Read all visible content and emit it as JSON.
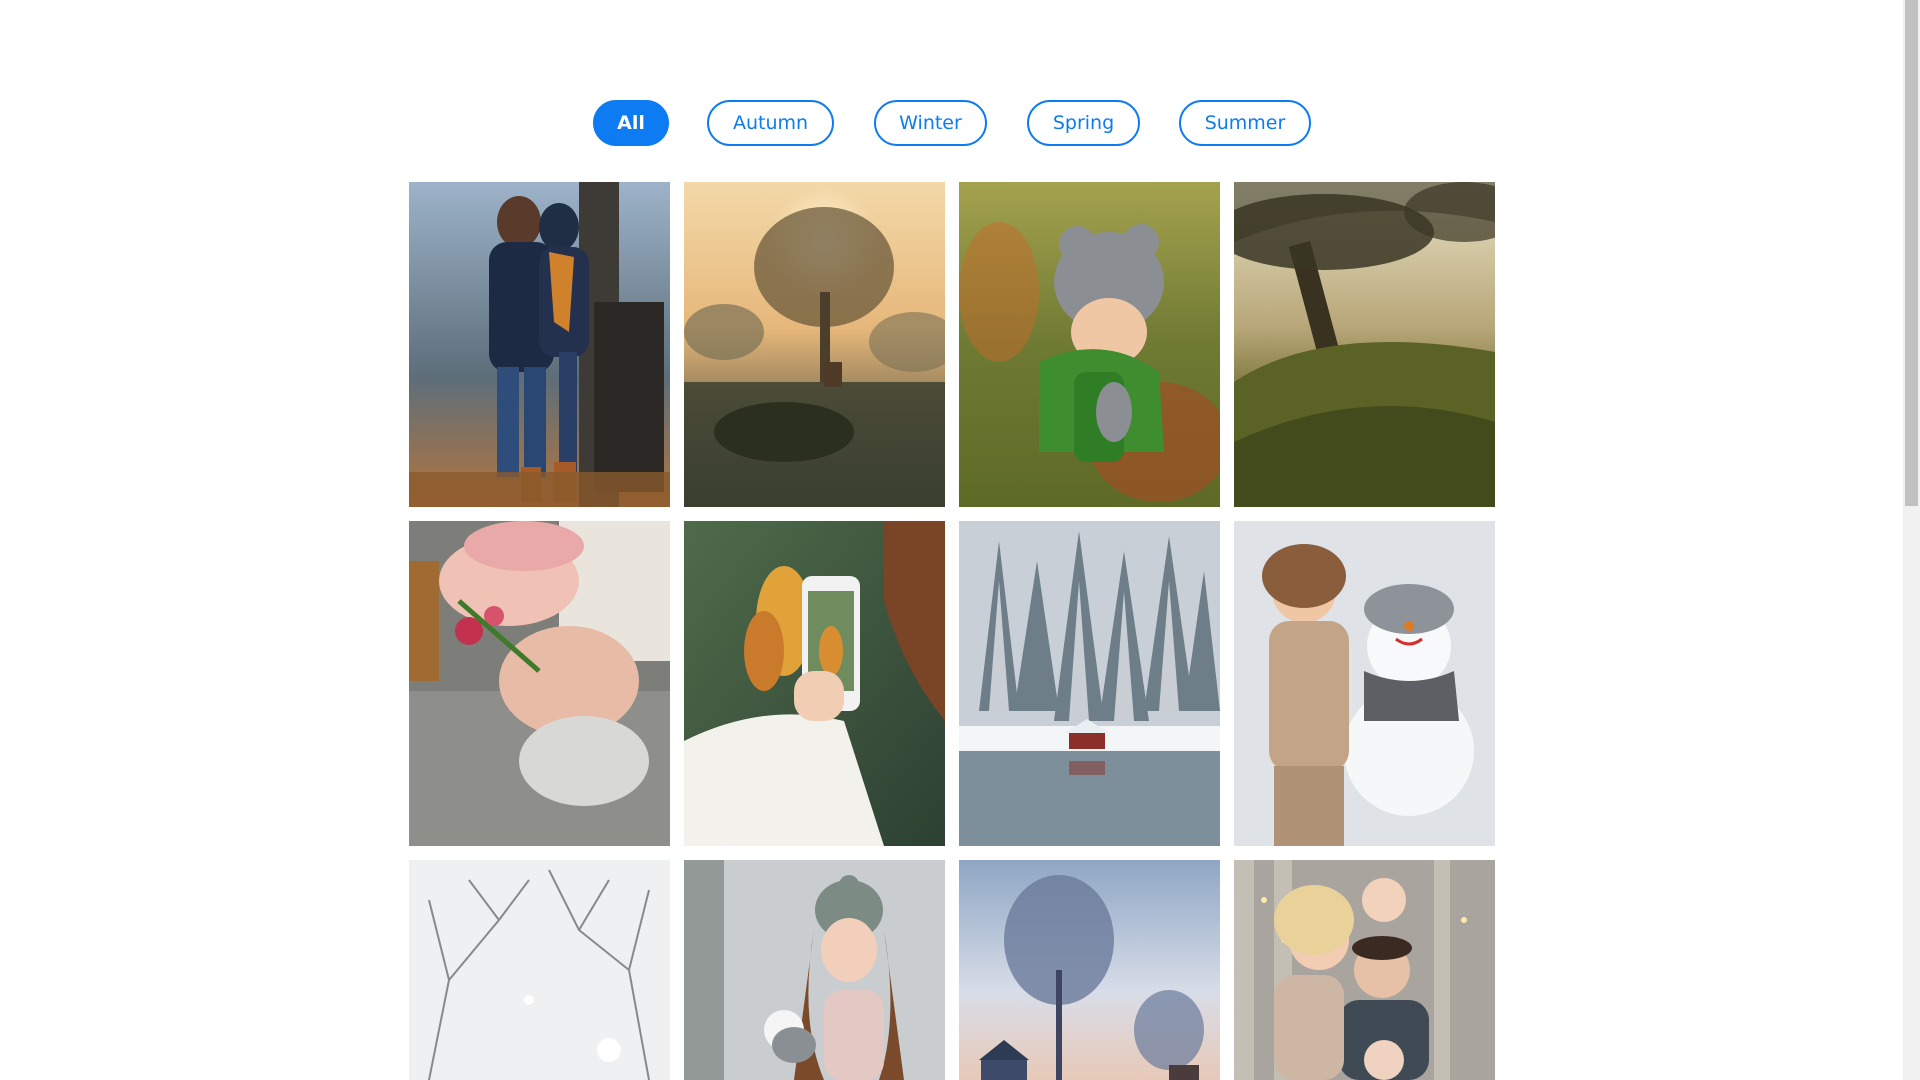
{
  "filters": [
    {
      "label": "All",
      "active": true
    },
    {
      "label": "Autumn",
      "active": false
    },
    {
      "label": "Winter",
      "active": false
    },
    {
      "label": "Spring",
      "active": false
    },
    {
      "label": "Summer",
      "active": false
    }
  ],
  "colors": {
    "accent": "#0d7bf2",
    "background": "#ffffff"
  },
  "gallery": {
    "tiles": [
      {
        "subject": "couple kissing in autumn forest"
      },
      {
        "subject": "tree at sunrise with horse in misty field"
      },
      {
        "subject": "toddler in knit bear hat in grass"
      },
      {
        "subject": "mossy hill with old tree in fog"
      },
      {
        "subject": "smiling couple lying in autumn leaves"
      },
      {
        "subject": "phone photo of autumn leaves"
      },
      {
        "subject": "snowy forest with cabin by lake"
      },
      {
        "subject": "girl hugging snowman"
      },
      {
        "subject": "snow covered tree branches"
      },
      {
        "subject": "woman in winter hat holding snowball"
      },
      {
        "subject": "frosty trees and winter village at dusk"
      },
      {
        "subject": "family portrait with string lights"
      }
    ]
  }
}
